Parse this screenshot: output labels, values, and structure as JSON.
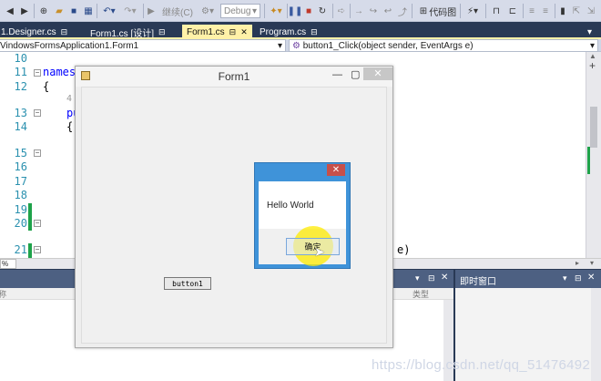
{
  "toolbar": {
    "debug_target_label": "继续(C)",
    "config_combo": "Debug",
    "code_map_label": "代码图"
  },
  "tabs": [
    {
      "label": "1.Designer.cs",
      "pin": "⊟"
    },
    {
      "label": "Form1.cs [设计]",
      "pin": "⊟"
    },
    {
      "label": "Form1.cs",
      "pin": "⊟",
      "active": true
    },
    {
      "label": "Program.cs",
      "pin": "⊟"
    }
  ],
  "navbar": {
    "left_combo": "VindowsFormsApplication1.Form1",
    "right_combo": "button1_Click(object sender, EventArgs e)"
  },
  "editor": {
    "line_numbers": [
      "10",
      "11",
      "12",
      "13",
      "14",
      "15",
      "16",
      "17",
      "18",
      "19",
      "20",
      "21"
    ],
    "code": {
      "l11": "names",
      "l12": "{",
      "l12b": "4",
      "l13": "pu",
      "l14": "{",
      "l21": "e)"
    }
  },
  "form1": {
    "title": "Form1",
    "button_label": "button1"
  },
  "messagebox": {
    "text": "Hello World",
    "ok_label": "确定",
    "close_glyph": "✕"
  },
  "bottom": {
    "left_pane_col1": "称",
    "left_pane_col2": "类型",
    "left_combo": "%",
    "right_pane_title": "即时窗口"
  },
  "watermark": "https://blog.csdn.net/qq_51476492"
}
